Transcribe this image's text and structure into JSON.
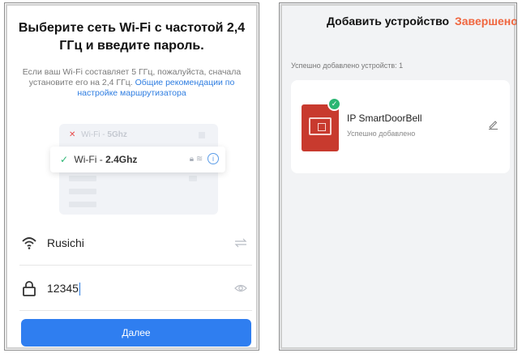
{
  "left": {
    "title": "Выберите сеть Wi-Fi с частотой 2,4 ГГц и введите пароль.",
    "description": "Если ваш Wi-Fi составляет 5 ГГц, пожалуйста, сначала установите его на 2,4 ГГц.",
    "description_link": "Общие рекомендации по настройке маршрутизатора",
    "illustration": {
      "row1_prefix": "Wi-Fi -",
      "row1_band": "5Ghz",
      "row2_prefix": "Wi-Fi -",
      "row2_band": "2.4Ghz"
    },
    "ssid": {
      "value": "Rusichi",
      "icon": "wifi-icon",
      "switch_icon": "swap-arrows-icon"
    },
    "password": {
      "value": "12345",
      "icon": "lock-icon",
      "visibility_icon": "eye-icon"
    },
    "next_button": "Далее"
  },
  "right": {
    "title": "Добавить устройство",
    "done": "Завершено",
    "count_text": "Успешно добавлено устройств: 1",
    "device": {
      "name": "IP SmartDoorBell",
      "status": "Успешно добавлено",
      "image": "doorbell-device-image",
      "edit_icon": "pencil-icon"
    }
  },
  "colors": {
    "primary": "#2f7ef0",
    "done": "#f0663f",
    "success": "#2bb673",
    "error": "#e84a4a",
    "device": "#c83a2e"
  }
}
